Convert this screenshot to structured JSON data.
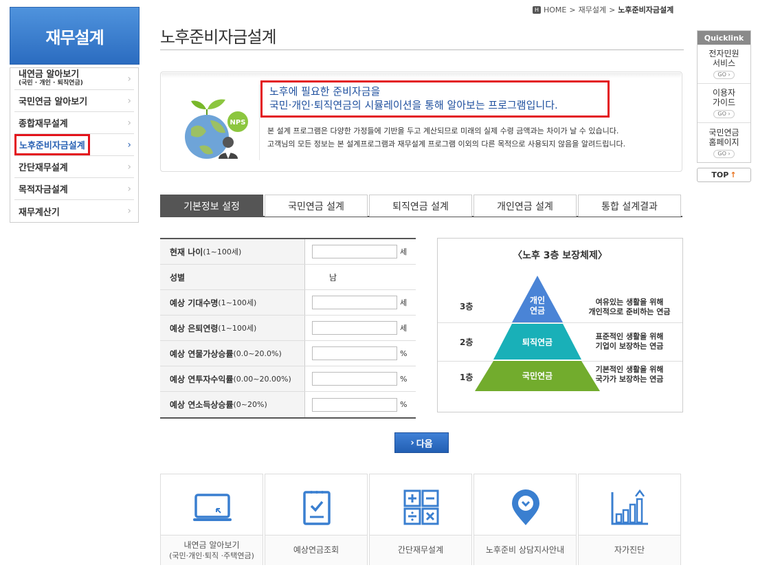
{
  "sidebar": {
    "title": "재무설계",
    "items": [
      {
        "label": "내연금 알아보기",
        "sub": "(국민 · 개인 · 퇴직연금)"
      },
      {
        "label": "국민연금 알아보기"
      },
      {
        "label": "종합재무설계"
      },
      {
        "label": "노후준비자금설계",
        "active": true
      },
      {
        "label": "간단재무설계"
      },
      {
        "label": "목적자금설계"
      },
      {
        "label": "재무계산기"
      }
    ]
  },
  "breadcrumb": {
    "home": "HOME",
    "sep": ">",
    "level1": "재무설계",
    "current": "노후준비자금설계"
  },
  "page_title": "노후준비자금설계",
  "intro": {
    "line1": "노후에 필요한 준비자금을",
    "line2": "국민·개인·퇴직연금의 시뮬레이션을 통해 알아보는 프로그램입니다.",
    "note1": "본 설계 프로그램은 다양한 가정들에 기반을 두고 계산되므로 미래의 실제 수령 금액과는 차이가 날 수 있습니다.",
    "note2": "고객님의 모든 정보는 본 설계프로그램과 재무설계 프로그램 이외의 다른 목적으로 사용되지 않음을 알려드립니다.",
    "badge": "NPS"
  },
  "tabs": [
    "기본정보 설정",
    "국민연금 설계",
    "퇴직연금 설계",
    "개인연금 설계",
    "통합 설계결과"
  ],
  "form": {
    "rows": [
      {
        "label": "현재 나이",
        "hint": "(1~100세)",
        "value": "",
        "unit": "세"
      },
      {
        "label": "성별",
        "hint": "",
        "value": "남",
        "unit": ""
      },
      {
        "label": "예상 기대수명",
        "hint": "(1~100세)",
        "value": "",
        "unit": "세"
      },
      {
        "label": "예상 은퇴연령",
        "hint": "(1~100세)",
        "value": "",
        "unit": "세"
      },
      {
        "label": "예상 연물가상승률",
        "hint": "(0.0~20.0%)",
        "value": "",
        "unit": "%"
      },
      {
        "label": "예상 연투자수익률",
        "hint": "(0.00~20.00%)",
        "value": "",
        "unit": "%"
      },
      {
        "label": "예상 연소득상승률",
        "hint": "(0~20%)",
        "value": "",
        "unit": "%"
      }
    ]
  },
  "pyramid": {
    "title": "〈노후 3층 보장체제〉",
    "levels": [
      {
        "level": "3층",
        "name1": "개인",
        "name2": "연금",
        "desc1": "여유있는 생활을 위해",
        "desc2": "개인적으로 준비하는 연금",
        "color": "#4a84d6"
      },
      {
        "level": "2층",
        "name1": "퇴직연금",
        "name2": "",
        "desc1": "표준적인 생활을 위해",
        "desc2": "기업이 보장하는 연금",
        "color": "#19b0b8"
      },
      {
        "level": "1층",
        "name1": "국민연금",
        "name2": "",
        "desc1": "기본적인 생활을 위해",
        "desc2": "국가가 보장하는 연금",
        "color": "#72ac2d"
      }
    ]
  },
  "next_button": "다음",
  "cards": [
    {
      "label": "내연금 알아보기",
      "sub": "(국민·개인·퇴직 ·주택연금)",
      "icon": "monitor-icon"
    },
    {
      "label": "예상연금조회",
      "sub": "",
      "icon": "clipboard-check-icon"
    },
    {
      "label": "간단재무설계",
      "sub": "",
      "icon": "calculator-icon"
    },
    {
      "label": "노후준비 상담지사안내",
      "sub": "",
      "icon": "location-pin-icon"
    },
    {
      "label": "자가진단",
      "sub": "",
      "icon": "bar-chart-icon"
    }
  ],
  "quicklink": {
    "title": "Quicklink",
    "items": [
      {
        "line1": "전자민원",
        "line2": "서비스",
        "go": "GO"
      },
      {
        "line1": "이용자",
        "line2": "가이드",
        "go": "GO"
      },
      {
        "line1": "국민연금",
        "line2": "홈페이지",
        "go": "GO"
      }
    ],
    "top": "TOP"
  },
  "colors": {
    "accent": "#2b6cc0",
    "highlight": "#e3131b",
    "icon": "#3a7fd0"
  }
}
